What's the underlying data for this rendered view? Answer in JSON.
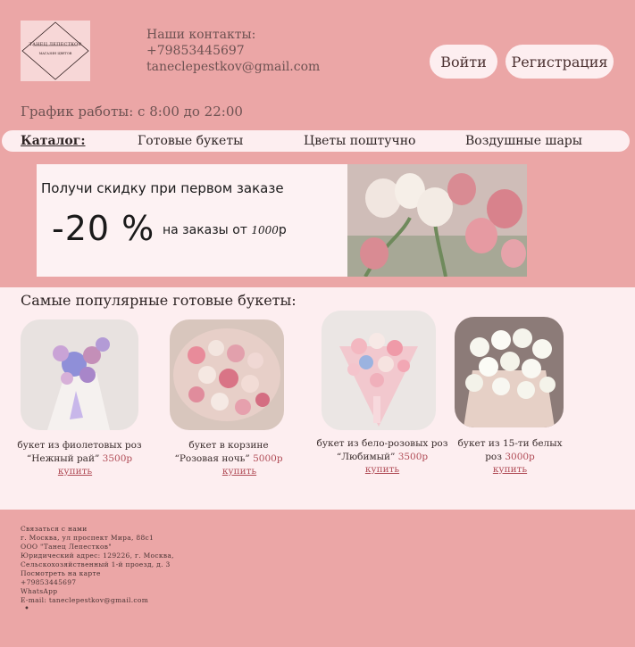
{
  "header": {
    "logo_name": "ТАНЕЦ ЛЕПЕСТКОВ",
    "logo_sub": "МАГАЗИН ЦВЕТОВ",
    "contacts_title": "Наши контакты:",
    "phone": "+79853445697",
    "email": "taneclepestkov@gmail.com",
    "login_label": "Войти",
    "register_label": "Регистрация",
    "schedule": "График работы: с 8:00 до 22:00"
  },
  "catalog": {
    "title": "Каталог:",
    "items": [
      "Готовые букеты",
      "Цветы поштучно",
      "Воздушные шары"
    ]
  },
  "promo": {
    "title": "Получи скидку при первом заказе",
    "discount": "-20 %",
    "text_prefix": "на заказы от ",
    "amount": "1000",
    "currency": "р"
  },
  "products": {
    "title": "Самые популярные готовые букеты:",
    "items": [
      {
        "line1": "букет из фиолетовых роз",
        "line2": "“Нежный рай”",
        "price": "3500р",
        "buy": "купить"
      },
      {
        "line1": "букет в корзине",
        "line2": "“Розовая ночь”",
        "price": "5000р",
        "buy": "купить"
      },
      {
        "line1": "букет из бело-розовых роз",
        "line2": "“Любимый”",
        "price": "3500р",
        "buy": "купить"
      },
      {
        "line1": "букет из 15-ти белых",
        "line2": "роз",
        "price": "3000р",
        "buy": "купить"
      }
    ]
  },
  "footer": {
    "lines": [
      "Связаться с нами",
      "г. Москва, ул проспект Мира, 88с1",
      "ООО \"Танец Лепестков\"",
      "Юридический адрес: 129226, г. Москва,",
      "Сельскохозяйственный 1-й проезд, д. 3",
      "Посмотреть на карте",
      "+79853445697",
      "WhatsApp",
      "E-mail: taneclepestkov@gmail.com"
    ],
    "bullet": "•"
  },
  "colors": {
    "background": "#eba6a6",
    "pill": "#fdeef0",
    "price": "#b04a55"
  }
}
